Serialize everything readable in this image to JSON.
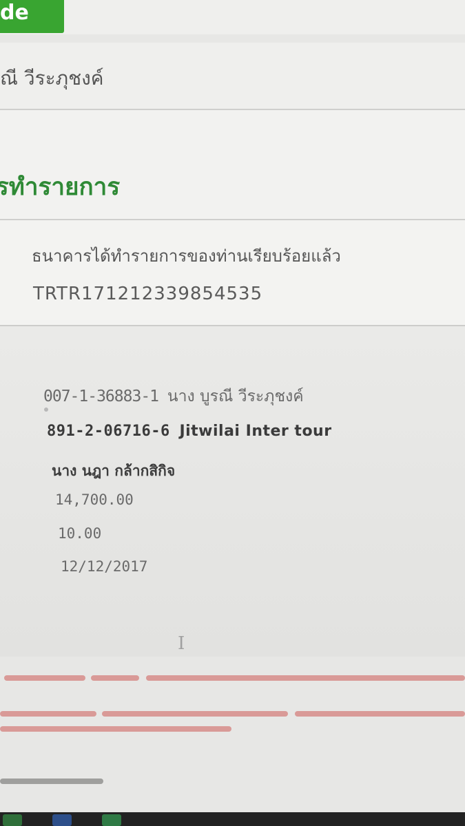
{
  "header": {
    "tab_label": "de",
    "account_holder": "ณี วีระภุชงค์"
  },
  "page_title": "รทำรายการ",
  "status": {
    "message": "ธนาคารได้ทำรายการของท่านเรียบร้อยแล้ว",
    "reference": "TRTR171212339854535"
  },
  "transfer": {
    "from_account": "007-1-36883-1",
    "from_name": "นาง บูรณี วีระภุชงค์",
    "to_account": "891-2-06716-6",
    "to_name": "Jitwilai Inter tour",
    "recipient_name": "นาง นฎา กล้ากสิกิจ",
    "amount": "14,700.00",
    "fee": "10.00",
    "date": "12/12/2017"
  },
  "colors": {
    "accent_green": "#39a531",
    "title_green": "#2f8a36",
    "note_red": "#d99a97"
  },
  "icons": [
    "text-cursor-icon",
    "taskbar-app-icon"
  ]
}
